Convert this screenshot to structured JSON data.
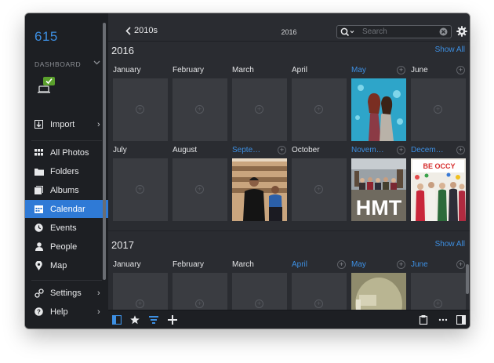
{
  "window": {
    "traffic_colors": [
      "#fe5f57",
      "#febc2e",
      "#28c840"
    ]
  },
  "sidebar": {
    "count": "615",
    "section_label": "DASHBOARD",
    "top_items": [
      {
        "label": "Import"
      }
    ],
    "nav_items": [
      {
        "label": "All Photos"
      },
      {
        "label": "Folders"
      },
      {
        "label": "Albums"
      },
      {
        "label": "Calendar",
        "active": true
      },
      {
        "label": "Events"
      },
      {
        "label": "People"
      },
      {
        "label": "Map"
      }
    ],
    "bottom_items": [
      {
        "label": "Settings"
      },
      {
        "label": "Help"
      }
    ]
  },
  "toolbar": {
    "back_label": "2010s",
    "title": "2016",
    "search_placeholder": "Search"
  },
  "years": [
    {
      "label": "2016",
      "show_all": "Show All",
      "months": [
        {
          "label": "January",
          "highlight": false
        },
        {
          "label": "February",
          "highlight": false
        },
        {
          "label": "March",
          "highlight": false
        },
        {
          "label": "April",
          "highlight": false
        },
        {
          "label": "May",
          "highlight": true
        },
        {
          "label": "June",
          "highlight": false
        },
        {
          "label": "July",
          "highlight": false
        },
        {
          "label": "August",
          "highlight": false
        },
        {
          "label": "Septe…",
          "highlight": true
        },
        {
          "label": "October",
          "highlight": false
        },
        {
          "label": "Novem…",
          "highlight": true
        },
        {
          "label": "Decem…",
          "highlight": true
        }
      ]
    },
    {
      "label": "2017",
      "show_all": "Show All",
      "months": [
        {
          "label": "January",
          "highlight": false
        },
        {
          "label": "February",
          "highlight": false
        },
        {
          "label": "March",
          "highlight": false
        },
        {
          "label": "April",
          "highlight": true
        },
        {
          "label": "May",
          "highlight": true
        },
        {
          "label": "June",
          "highlight": true
        }
      ]
    }
  ],
  "photos": {
    "nov_sign": "HMT",
    "dec_banner": "BE OCCY"
  },
  "colors": {
    "accent": "#3d8fe2",
    "sidebar_bg": "#1d1f23",
    "content_bg": "#2a2c31",
    "tile_bg": "#3a3c41"
  }
}
